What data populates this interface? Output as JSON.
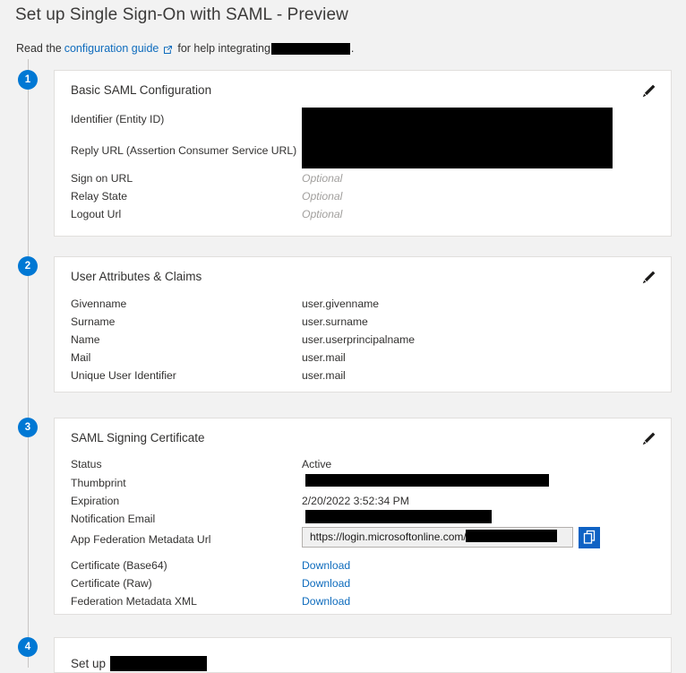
{
  "header": {
    "title": "Set up Single Sign-On with SAML - Preview",
    "subtitle_prefix": "Read the",
    "link_label": "configuration guide",
    "link_icon": "external-link-icon",
    "subtitle_middle": "for help integrating",
    "subtitle_redacted": "",
    "subtitle_suffix": "."
  },
  "colors": {
    "accent": "#0078d4",
    "link": "#0f6cbd",
    "page_background": "#f2f2f2",
    "card_background": "#ffffff",
    "card_border": "#e1dfdd",
    "redaction": "#000000",
    "copy_button": "#0f62c4"
  },
  "sections": [
    {
      "step": "1",
      "title": "Basic SAML Configuration",
      "edit_icon": "pencil-icon",
      "rows": [
        {
          "label": "Identifier (Entity ID)",
          "value": "",
          "style": "redacted"
        },
        {
          "label": "Reply URL (Assertion Consumer Service URL)",
          "value": "",
          "style": "redacted"
        },
        {
          "label": "Sign on URL",
          "value": "Optional",
          "style": "optional"
        },
        {
          "label": "Relay State",
          "value": "Optional",
          "style": "optional"
        },
        {
          "label": "Logout Url",
          "value": "Optional",
          "style": "optional"
        }
      ]
    },
    {
      "step": "2",
      "title": "User Attributes & Claims",
      "edit_icon": "pencil-icon",
      "rows": [
        {
          "label": "Givenname",
          "value": "user.givenname",
          "style": "text"
        },
        {
          "label": "Surname",
          "value": "user.surname",
          "style": "text"
        },
        {
          "label": "Name",
          "value": "user.userprincipalname",
          "style": "text"
        },
        {
          "label": "Mail",
          "value": "user.mail",
          "style": "text"
        },
        {
          "label": "Unique User Identifier",
          "value": "user.mail",
          "style": "text"
        }
      ]
    },
    {
      "step": "3",
      "title": "SAML Signing Certificate",
      "edit_icon": "pencil-icon",
      "rows": [
        {
          "label": "Status",
          "value": "Active",
          "style": "text"
        },
        {
          "label": "Thumbprint",
          "value": "",
          "style": "redacted"
        },
        {
          "label": "Expiration",
          "value": "2/20/2022 3:52:34 PM",
          "style": "text"
        },
        {
          "label": "Notification Email",
          "value": "",
          "style": "redacted"
        },
        {
          "label": "App Federation Metadata Url",
          "value": "https://login.microsoftonline.com/",
          "style": "url-field"
        },
        {
          "label": "Certificate (Base64)",
          "value": "Download",
          "style": "link"
        },
        {
          "label": "Certificate (Raw)",
          "value": "Download",
          "style": "link"
        },
        {
          "label": "Federation Metadata XML",
          "value": "Download",
          "style": "link"
        }
      ],
      "copy_icon": "copy-icon",
      "copy_tooltip": "Copy"
    },
    {
      "step": "4",
      "title_prefix": "Set up",
      "title_redacted": "",
      "rows": []
    }
  ]
}
